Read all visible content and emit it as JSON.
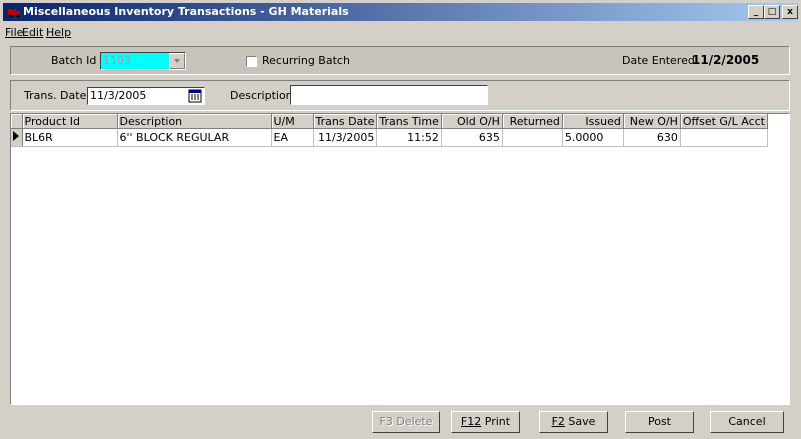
{
  "window": {
    "title": "Miscellaneous Inventory Transactions - GH Materials",
    "controls": {
      "minimize": "_",
      "maximize": "□",
      "close": "x"
    }
  },
  "menu": [
    "File",
    "Edit",
    "Help"
  ],
  "batch": {
    "batch_id_label": "Batch Id",
    "batch_id_value": "1103",
    "recurring_label": "Recurring Batch",
    "recurring_checked": false,
    "date_entered_label": "Date Entered",
    "date_entered_value": "11/2/2005"
  },
  "trans": {
    "trans_date_label": "Trans. Date",
    "trans_date_value": "11/3/2005",
    "description_label": "Description",
    "description_value": ""
  },
  "grid": {
    "columns": [
      "Product Id",
      "Description",
      "U/M",
      "Trans Date",
      "Trans Time",
      "Old O/H",
      "Returned",
      "Issued",
      "New O/H",
      "Offset G/L Acct"
    ],
    "rows": [
      {
        "product_id": "BL6R",
        "description": "6'' BLOCK REGULAR",
        "um": "EA",
        "trans_date": "11/3/2005",
        "trans_time": "11:52",
        "old_oh": "635",
        "returned": "",
        "issued": "5.0000",
        "new_oh": "630",
        "offset_gl": ""
      }
    ]
  },
  "buttons": {
    "delete": "F3  Delete",
    "print": "Print",
    "print_key": "F12",
    "save": "Save",
    "save_key": "F2",
    "post": "Post",
    "cancel": "Cancel"
  },
  "colors": {
    "title_start": "#0a246a",
    "title_end": "#a6caf0",
    "batch_id_bg": "#00ffff",
    "face": "#d4d0c8"
  }
}
